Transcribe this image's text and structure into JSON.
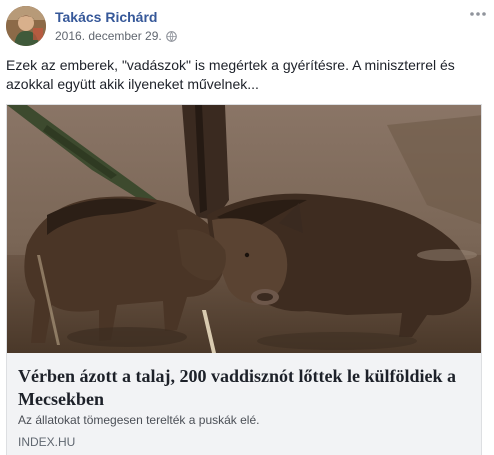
{
  "post": {
    "author": "Takács Richárd",
    "timestamp": "2016. december 29.",
    "text": "Ezek az emberek, \"vadászok\" is megértek a gyérítésre. A miniszterrel és azokkal együtt akik ilyeneket művelnek...",
    "privacy_icon": "globe-icon",
    "menu_icon": "more-options-icon"
  },
  "link_preview": {
    "image_subject": "wild-boars-photo",
    "title": "Vérben ázott a talaj, 200 vaddisznót lőttek le külföldiek a Mecsekben",
    "description": "Az állatokat tömegesen terelték a puskák elé.",
    "domain": "INDEX.HU"
  },
  "colors": {
    "author_link": "#365899",
    "meta_text": "#616770",
    "card_background": "#f2f3f5",
    "card_border": "#dddfe2"
  }
}
